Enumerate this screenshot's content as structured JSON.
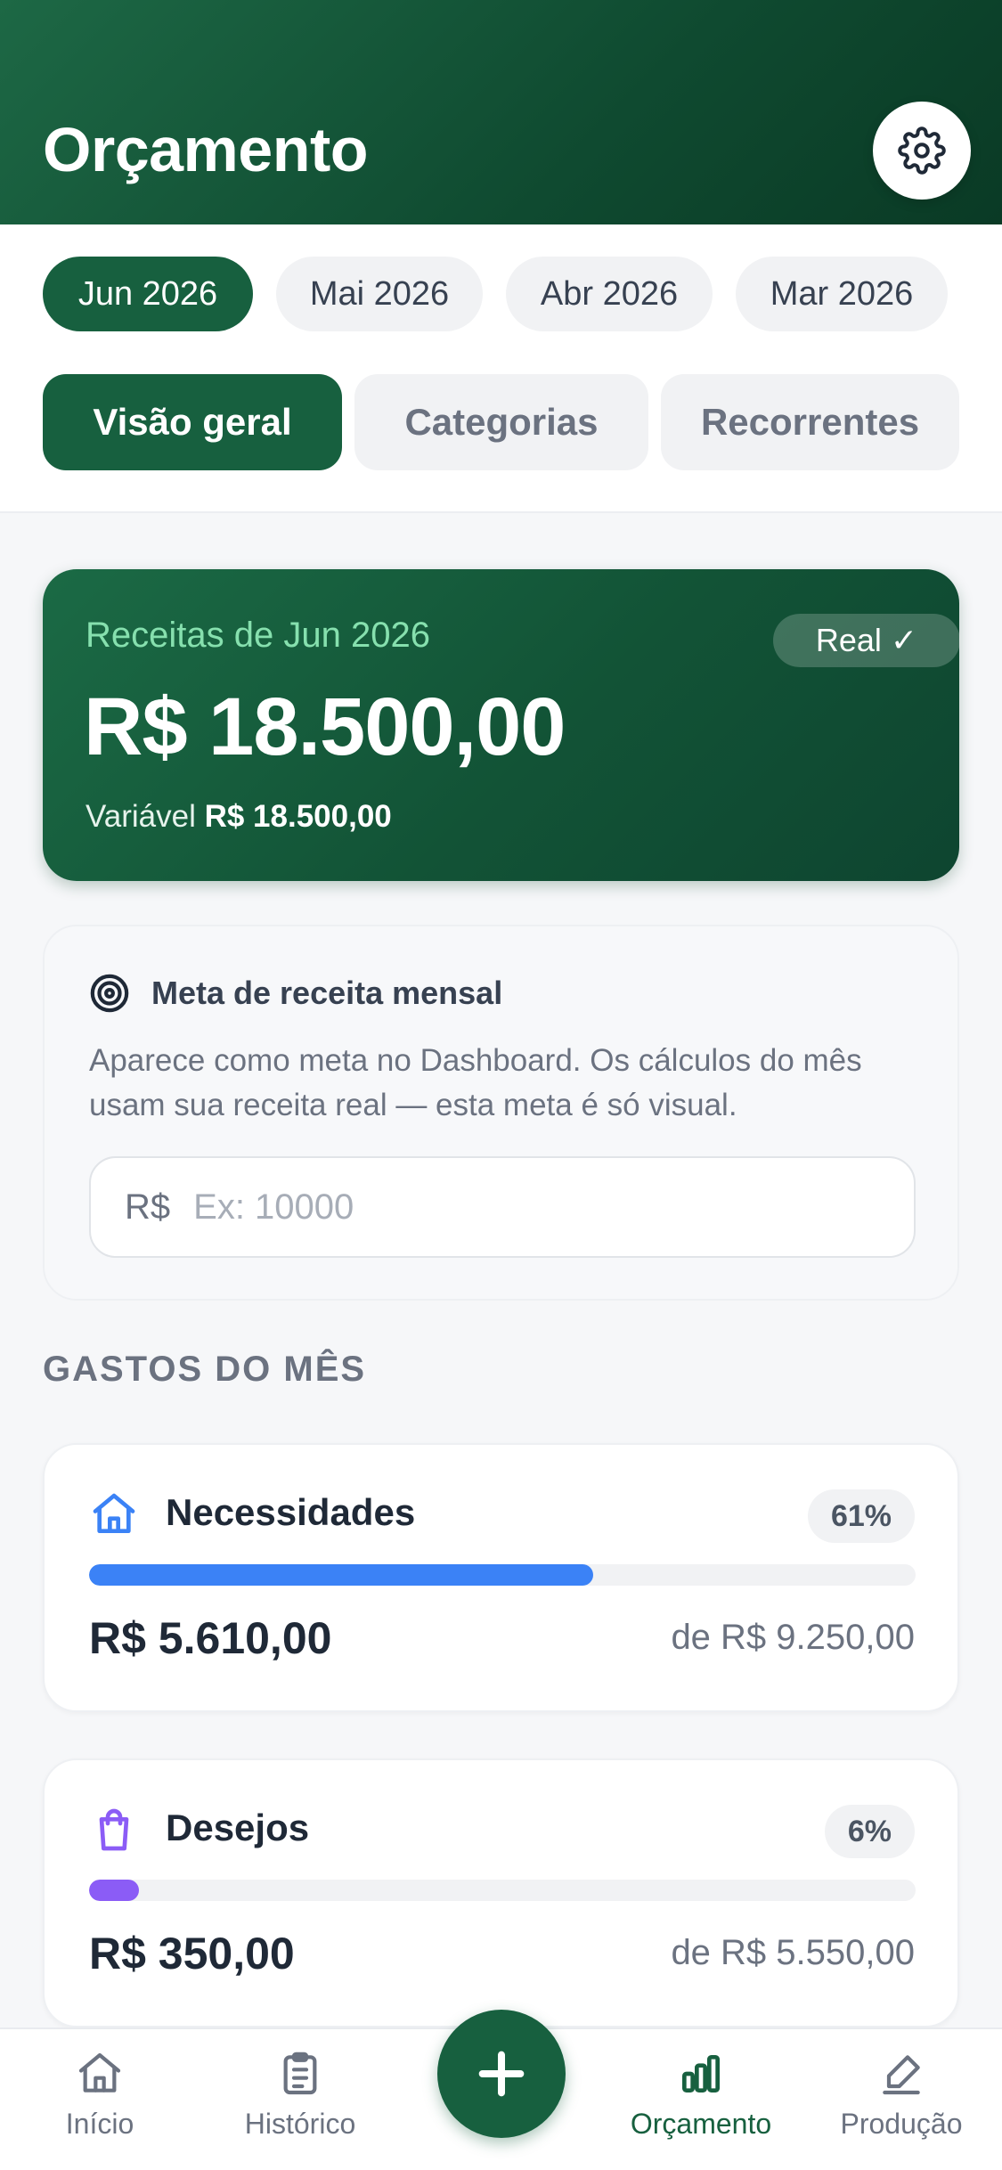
{
  "header": {
    "title": "Orçamento"
  },
  "months": [
    "Jun 2026",
    "Mai 2026",
    "Abr 2026",
    "Mar 2026"
  ],
  "selected_month": "Jun 2026",
  "view_tabs": [
    "Visão geral",
    "Categorias",
    "Recorrentes"
  ],
  "selected_view": "Visão geral",
  "income": {
    "label": "Receitas de Jun 2026",
    "amount": "R$ 18.500,00",
    "variable_label": "Variável",
    "variable_amount": "R$ 18.500,00",
    "badge": "Real ✓"
  },
  "goal": {
    "title": "Meta de receita mensal",
    "description": "Aparece como meta no Dashboard. Os cálculos do mês usam sua receita real — esta meta é só visual.",
    "currency_prefix": "R$",
    "placeholder": "Ex: 10000",
    "value": ""
  },
  "section_title": "GASTOS DO MÊS",
  "budgets": [
    {
      "name": "Necessidades",
      "percent": "61%",
      "progress": 0.61,
      "spent": "R$ 5.610,00",
      "limit": "de R$ 9.250,00",
      "color": "#3b82f6",
      "icon": "house-icon"
    },
    {
      "name": "Desejos",
      "percent": "6%",
      "progress": 0.06,
      "spent": "R$ 350,00",
      "limit": "de R$ 5.550,00",
      "color": "#8b5cf6",
      "icon": "shopping-bag-icon"
    }
  ],
  "nav": {
    "items": [
      "Início",
      "Histórico",
      "Orçamento",
      "Produção"
    ],
    "active": "Orçamento",
    "fab": "plus-icon"
  },
  "colors": {
    "primary": "#17603f",
    "accent_green": "#86e0ae",
    "needs": "#3b82f6",
    "wants": "#8b5cf6"
  }
}
